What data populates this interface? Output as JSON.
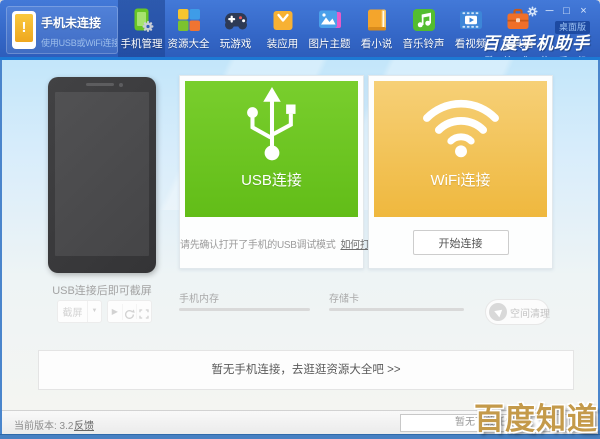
{
  "window": {
    "badge": "桌面版",
    "title": "百度手机助手",
    "subtitle": "酷 炫 你 的 手 机"
  },
  "connection_status": {
    "title": "手机未连接",
    "subtitle": "使用USB或WiFi连接"
  },
  "toolbar": {
    "tabs": [
      {
        "label": "手机管理",
        "active": true
      },
      {
        "label": "资源大全"
      },
      {
        "label": "玩游戏"
      },
      {
        "label": "装应用"
      },
      {
        "label": "图片主题"
      },
      {
        "label": "看小说"
      },
      {
        "label": "音乐铃声"
      },
      {
        "label": "看视频"
      },
      {
        "label": "工具箱"
      }
    ]
  },
  "phone_preview": {
    "caption": "USB连接后即可截屏",
    "screenshot_button": "截屏"
  },
  "usb_panel": {
    "title": "USB连接",
    "hint": "请先确认打开了手机的USB调试模式",
    "help_link": "如何打开"
  },
  "wifi_panel": {
    "title": "WiFi连接",
    "connect_button": "开始连接"
  },
  "storage": {
    "internal_label": "手机内存",
    "sdcard_label": "存储卡",
    "clean_button": "空间清理"
  },
  "banner": {
    "message": "暂无手机连接，去逛逛资源大全吧 >>"
  },
  "status_bar": {
    "version": "当前版本: 3.2",
    "feedback_link": "反馈",
    "download_status": "暂无下载任务"
  },
  "watermark": "百度知道",
  "icons": {
    "alert": "!",
    "minimize": "─",
    "maximize": "□",
    "close": "×",
    "play": "▶",
    "dropdown_arrow": "▼"
  },
  "colors": {
    "toolbar_blue": "#3568c8",
    "active_tab_blue": "#2a549f",
    "usb_green": "#6cc622",
    "wifi_yellow": "#f2c157",
    "sky_background": "#c3e6fa",
    "watermark_gold": "#c49a4a"
  }
}
